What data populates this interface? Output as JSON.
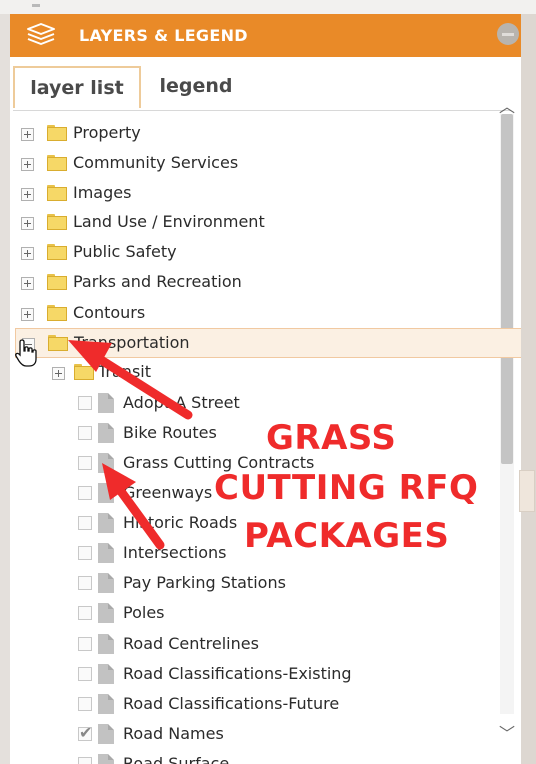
{
  "panel": {
    "header": {
      "title": "LAYERS & LEGEND",
      "icon": "layers-icon",
      "collapse_icon": "minus-circle-icon"
    },
    "tabs": [
      {
        "label": "layer list",
        "active": true
      },
      {
        "label": "legend",
        "active": false
      }
    ],
    "scroll": {
      "up_glyph": "⌃",
      "down_glyph": "⌄"
    }
  },
  "tree": {
    "groups": [
      {
        "label": "Property",
        "expanded": false
      },
      {
        "label": "Community Services",
        "expanded": false
      },
      {
        "label": "Images",
        "expanded": false
      },
      {
        "label": "Land Use / Environment",
        "expanded": false
      },
      {
        "label": "Public Safety",
        "expanded": false
      },
      {
        "label": "Parks and Recreation",
        "expanded": false
      },
      {
        "label": "Contours",
        "expanded": false
      },
      {
        "label": "Transportation",
        "expanded": true,
        "selected": true
      }
    ],
    "subgroup": {
      "label": "Transit",
      "expanded": false
    },
    "layers": [
      {
        "label": "Adopt A Street",
        "checked": false
      },
      {
        "label": "Bike Routes",
        "checked": false
      },
      {
        "label": "Grass Cutting Contracts",
        "checked": false
      },
      {
        "label": "Greenways",
        "checked": false
      },
      {
        "label": "Historic Roads",
        "checked": false
      },
      {
        "label": "Intersections",
        "checked": false
      },
      {
        "label": "Pay Parking Stations",
        "checked": false
      },
      {
        "label": "Poles",
        "checked": false
      },
      {
        "label": "Road Centrelines",
        "checked": false
      },
      {
        "label": "Road Classifications-Existing",
        "checked": false
      },
      {
        "label": "Road Classifications-Future",
        "checked": false
      },
      {
        "label": "Road Names",
        "checked": true
      },
      {
        "label": "Road Surface",
        "checked": false
      }
    ]
  },
  "annotation": {
    "lines": [
      "GRASS",
      "CUTTING RFQ",
      "PACKAGES"
    ],
    "color": "#ef2b2b"
  },
  "colors": {
    "accent": "#e98a28",
    "selection": "#fbf0e3"
  }
}
